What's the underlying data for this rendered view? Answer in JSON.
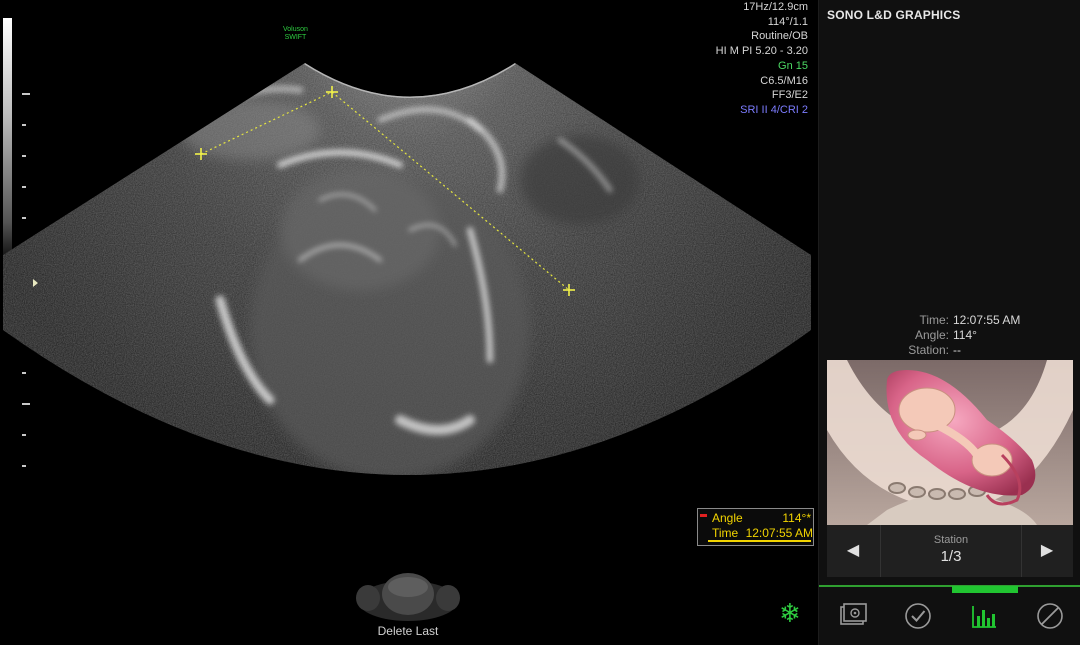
{
  "scanner": {
    "brand_line1": "Voluson",
    "brand_line2": "SWIFT",
    "params": [
      "17Hz/12.9cm",
      "114°/1.1",
      "Routine/OB",
      "HI M PI 5.20 - 3.20",
      "Gn  15",
      "C6.5/M16",
      "FF3/E2",
      "SRI II 4/CRI 2"
    ]
  },
  "measurement": {
    "angle_label": "Angle",
    "angle_value": "114°*",
    "time_label": "Time",
    "time_value": "12:07:55 AM"
  },
  "controls": {
    "delete_last_label": "Delete Last",
    "freeze_icon": "snowflake-icon"
  },
  "panel": {
    "title": "SONO L&D GRAPHICS",
    "info": [
      {
        "key": "Time:",
        "value": "12:07:55 AM"
      },
      {
        "key": "Angle:",
        "value": "114°"
      },
      {
        "key": "Station:",
        "value": "--"
      }
    ],
    "nav": {
      "prev_icon": "left-arrow-icon",
      "next_icon": "right-arrow-icon",
      "label": "Station",
      "value": "1/3"
    },
    "tools": [
      "image-gallery-icon",
      "checkmark-icon",
      "bar-chart-icon",
      "cancel-icon"
    ],
    "active_tool": "bar-chart-icon"
  },
  "colors": {
    "accent_green": "#21c531",
    "measure_yellow": "#f2d400",
    "param_blue": "#7c7cff"
  }
}
